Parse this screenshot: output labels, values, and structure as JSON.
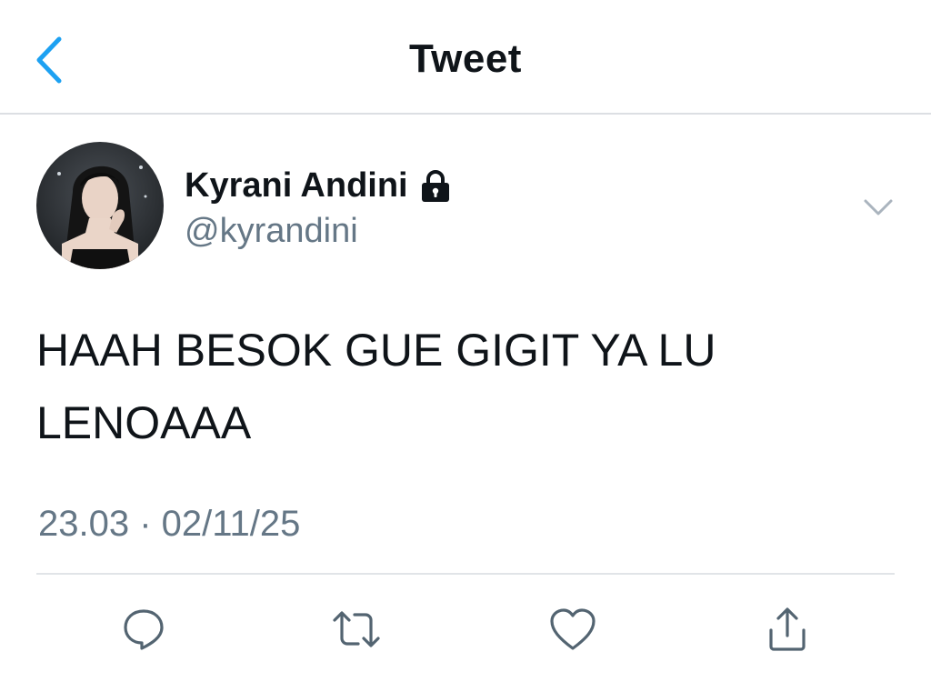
{
  "header": {
    "title": "Tweet",
    "back_icon": "chevron-left-icon"
  },
  "author": {
    "display_name": "Kyrani Andini",
    "handle": "@kyrandini",
    "protected_icon": "lock-icon"
  },
  "tweet": {
    "text": "HAAH BESOK GUE GIGIT YA LU LENOAAA",
    "timestamp": "23.03 · 02/11/25"
  },
  "actions": [
    {
      "name": "reply",
      "icon": "reply-icon"
    },
    {
      "name": "retweet",
      "icon": "retweet-icon"
    },
    {
      "name": "like",
      "icon": "heart-icon"
    },
    {
      "name": "share",
      "icon": "share-icon"
    }
  ],
  "colors": {
    "accent": "#1da1f2",
    "text_primary": "#0f1419",
    "text_secondary": "#657786",
    "divider": "#e1e4e8"
  }
}
